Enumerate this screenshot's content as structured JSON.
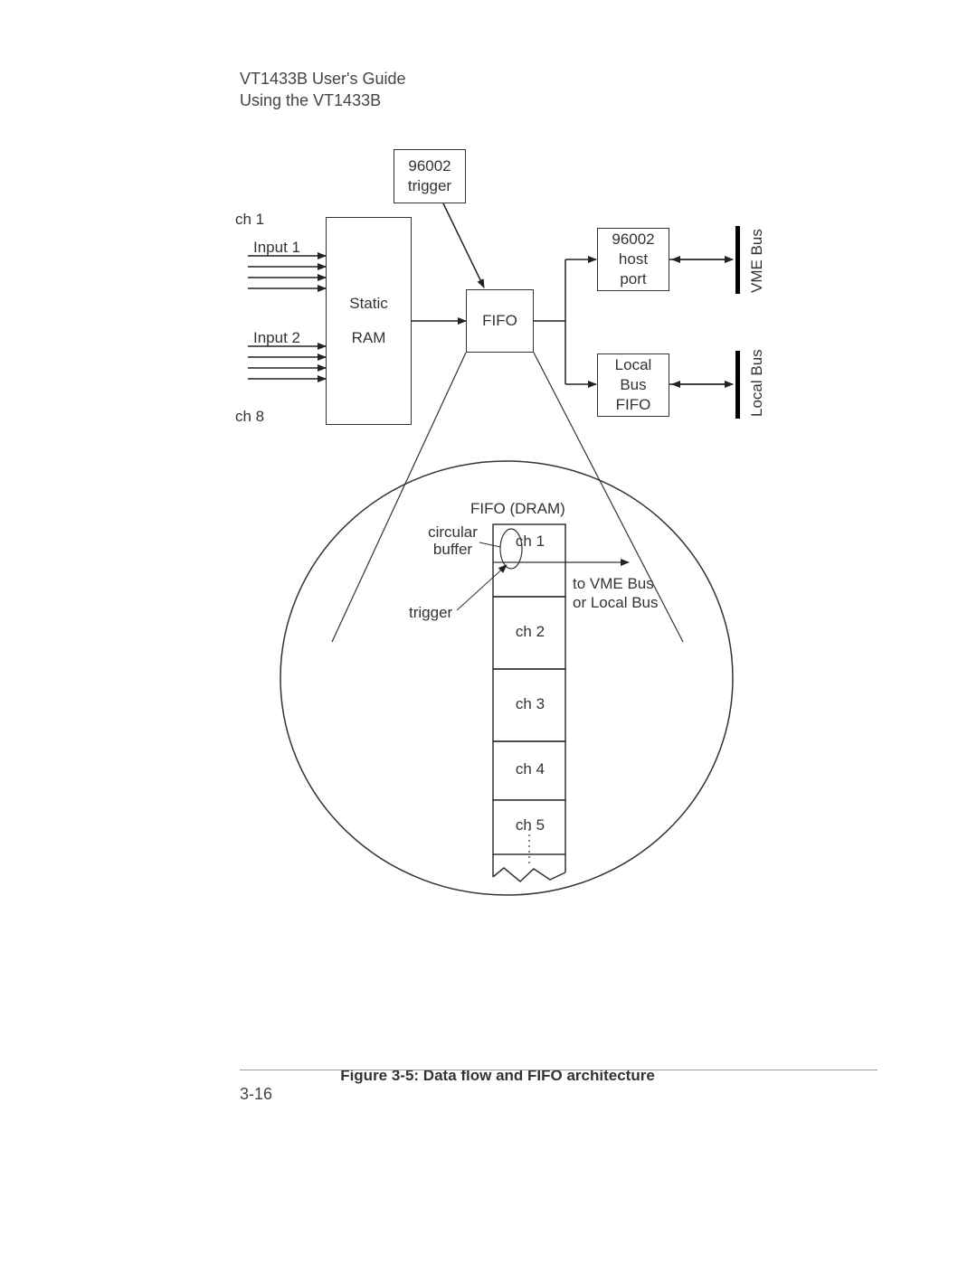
{
  "header": {
    "line1": "VT1433B User's Guide",
    "line2": "Using the VT1433B"
  },
  "diagram": {
    "trigger_box": {
      "line1": "96002",
      "line2": "trigger"
    },
    "ch1_label": "ch 1",
    "input1_label": "Input 1",
    "input2_label": "Input 2",
    "ch8_label": "ch 8",
    "static_ram": {
      "line1": "Static",
      "line2": "RAM"
    },
    "fifo": "FIFO",
    "host_port": {
      "line1": "96002",
      "line2": "host",
      "line3": "port"
    },
    "local_bus_fifo": {
      "line1": "Local",
      "line2": "Bus",
      "line3": "FIFO"
    },
    "vme_bus_label": "VME Bus",
    "local_bus_label": "Local Bus",
    "magnified": {
      "title": "FIFO (DRAM)",
      "circular_buffer": "circular buffer",
      "trigger_label": "trigger",
      "to_bus": {
        "line1": "to VME Bus",
        "line2": "or Local Bus"
      },
      "segments": [
        "ch 1",
        "ch 2",
        "ch 3",
        "ch 4",
        "ch 5"
      ]
    }
  },
  "caption": "Figure 3-5:  Data flow and FIFO architecture",
  "page_number": "3-16"
}
